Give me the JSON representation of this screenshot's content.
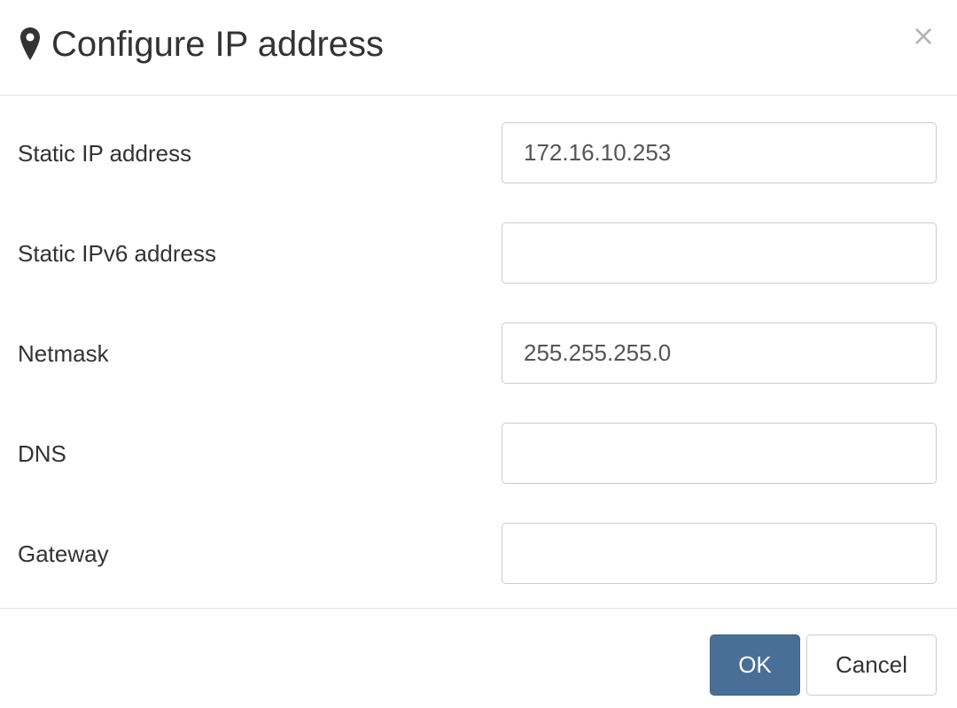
{
  "dialog": {
    "title": "Configure IP address",
    "title_icon": "map-marker-icon",
    "close_label": "×"
  },
  "fields": [
    {
      "label": "Static IP address",
      "value": "172.16.10.253",
      "placeholder": ""
    },
    {
      "label": "Static IPv6 address",
      "value": "",
      "placeholder": ""
    },
    {
      "label": "Netmask",
      "value": "255.255.255.0",
      "placeholder": ""
    },
    {
      "label": "DNS",
      "value": "",
      "placeholder": ""
    },
    {
      "label": "Gateway",
      "value": "",
      "placeholder": ""
    }
  ],
  "footer": {
    "ok_label": "OK",
    "cancel_label": "Cancel"
  },
  "colors": {
    "primary": "#4a6f96",
    "text": "#333333",
    "border": "#cccccc"
  }
}
